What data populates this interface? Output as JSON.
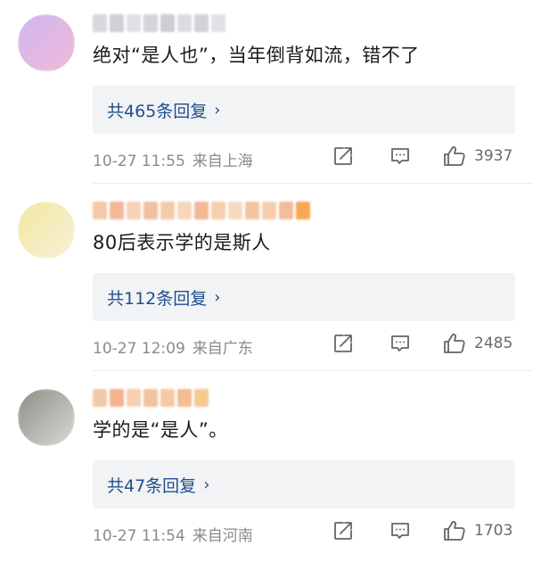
{
  "comments": [
    {
      "content": "绝对“是人也”，当年倒背如流，错不了",
      "reply_label": "共465条回复",
      "reply_arrow": "›",
      "time": "10-27 11:55",
      "location": "来自上海",
      "likes": "3937",
      "avatar_colors": [
        "#cdb7f2",
        "#f3b9d6"
      ],
      "name_colors": [
        "#d8d8dc",
        "#cfcfd4",
        "#e0e0e4",
        "#d4d4d9",
        "#cdcdd2",
        "#dcdce0",
        "#d2d2d7",
        "#e2e2e6"
      ]
    },
    {
      "content": "80后表示学的是斯人",
      "reply_label": "共112条回复",
      "reply_arrow": "›",
      "time": "10-27 12:09",
      "location": "来自广东",
      "likes": "2485",
      "avatar_colors": [
        "#f3e6a0",
        "#f7f2d8"
      ],
      "name_colors": [
        "#f5c9a8",
        "#f2b89a",
        "#f6d2b6",
        "#f0c0a0",
        "#f4cba8",
        "#f7d7bc",
        "#f1b996",
        "#f5cfae",
        "#f8d9bf",
        "#f3c4a2",
        "#f6ceae",
        "#f2bc98",
        "#f7a854"
      ]
    },
    {
      "content": "学的是“是人”。",
      "reply_label": "共47条回复",
      "reply_arrow": "›",
      "time": "10-27 11:54",
      "location": "来自河南",
      "likes": "1703",
      "avatar_colors": [
        "#8a8f86",
        "#d9dbd5"
      ],
      "name_colors": [
        "#f2c9a8",
        "#f4b38e",
        "#f6d0b0",
        "#f1c3a0",
        "#f5c8a6",
        "#f3bc94",
        "#f6c990"
      ]
    }
  ]
}
